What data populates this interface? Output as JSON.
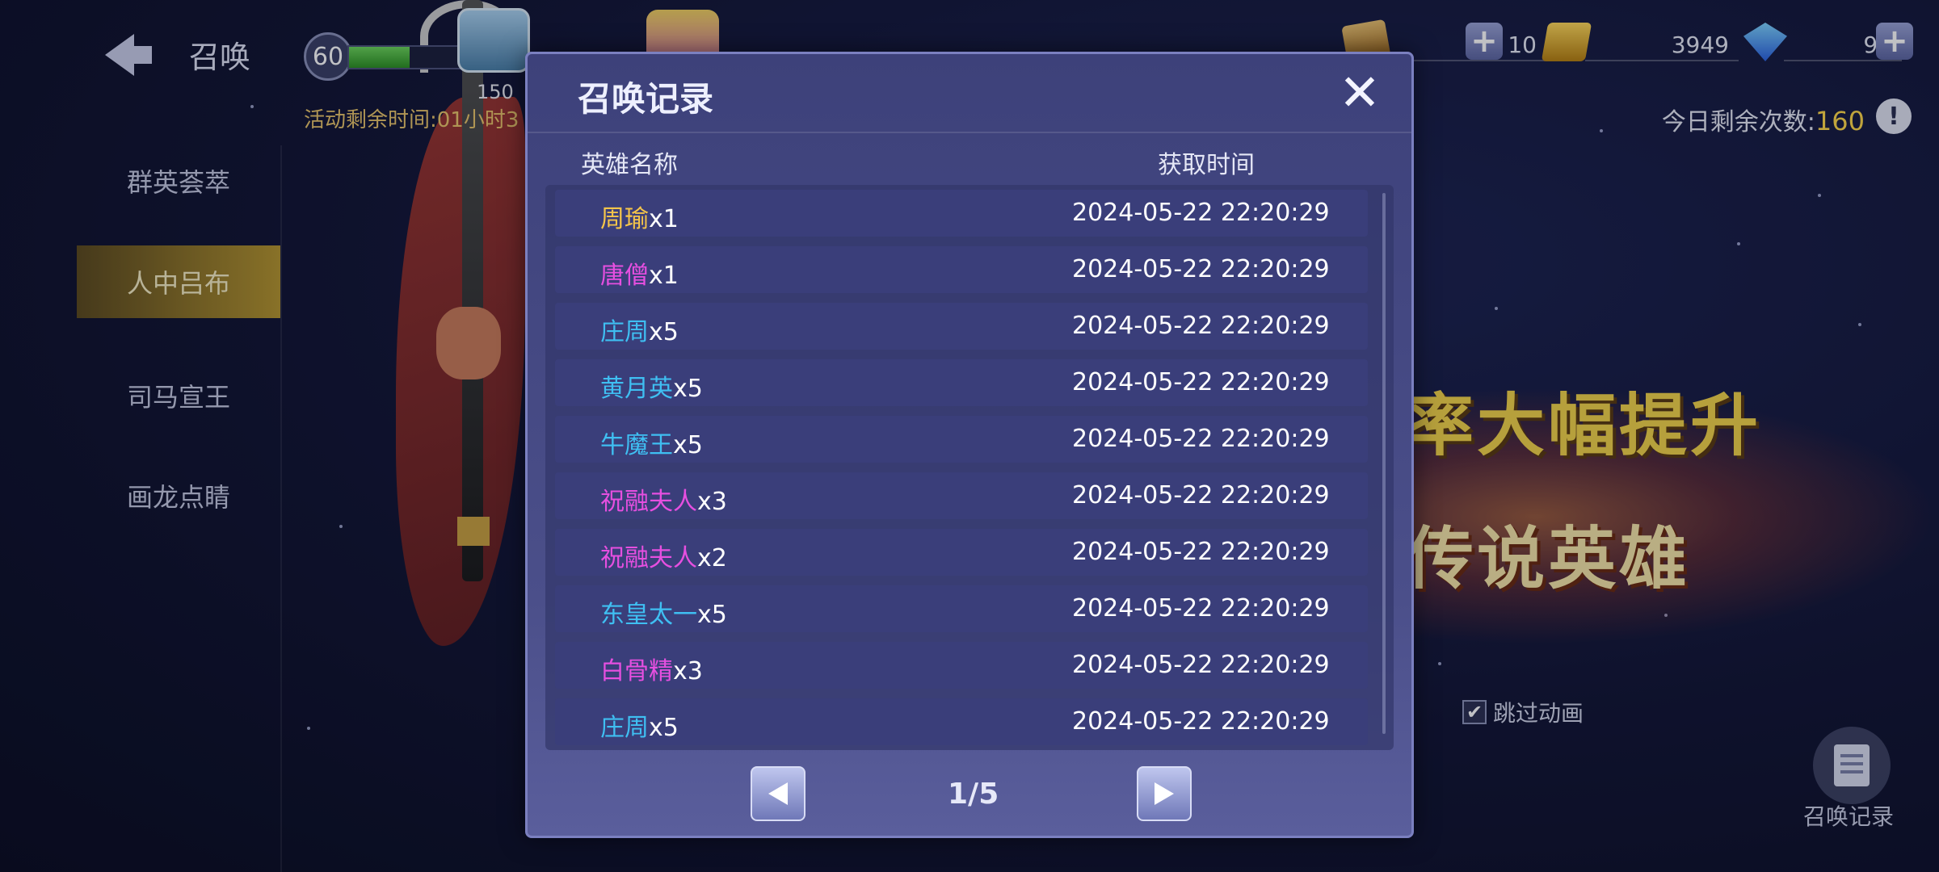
{
  "header": {
    "back_title": "召唤",
    "level": "60",
    "level_progress": 0.48,
    "chest_count": "150",
    "activity_text": "活动剩余时间:01小时3"
  },
  "currencies": {
    "tickets": "10",
    "gold": "3949",
    "gems": "91"
  },
  "remaining": {
    "label": "今日剩余次数:",
    "value": "160"
  },
  "sidebar": {
    "items": [
      {
        "label": "群英荟萃",
        "active": false
      },
      {
        "label": "人中吕布",
        "active": true
      },
      {
        "label": "司马宣王",
        "active": false
      },
      {
        "label": "画龙点睛",
        "active": false
      }
    ]
  },
  "banner": {
    "line1": "率大幅提升",
    "line2": "传说英雄"
  },
  "skip_animation": {
    "label": "跳过动画",
    "checked": true
  },
  "record_button": {
    "label": "召唤记录"
  },
  "dialog": {
    "title": "召唤记录",
    "col_name": "英雄名称",
    "col_time": "获取时间",
    "rows": [
      {
        "hero": "周瑜",
        "count": "x1",
        "time": "2024-05-22 22:20:29",
        "rarity_color": "#f5c54a"
      },
      {
        "hero": "唐僧",
        "count": "x1",
        "time": "2024-05-22 22:20:29",
        "rarity_color": "#e64fe0"
      },
      {
        "hero": "庄周",
        "count": "x5",
        "time": "2024-05-22 22:20:29",
        "rarity_color": "#3fbff2"
      },
      {
        "hero": "黄月英",
        "count": "x5",
        "time": "2024-05-22 22:20:29",
        "rarity_color": "#3fbff2"
      },
      {
        "hero": "牛魔王",
        "count": "x5",
        "time": "2024-05-22 22:20:29",
        "rarity_color": "#3fbff2"
      },
      {
        "hero": "祝融夫人",
        "count": "x3",
        "time": "2024-05-22 22:20:29",
        "rarity_color": "#e64fe0"
      },
      {
        "hero": "祝融夫人",
        "count": "x2",
        "time": "2024-05-22 22:20:29",
        "rarity_color": "#e64fe0"
      },
      {
        "hero": "东皇太一",
        "count": "x5",
        "time": "2024-05-22 22:20:29",
        "rarity_color": "#3fbff2"
      },
      {
        "hero": "白骨精",
        "count": "x3",
        "time": "2024-05-22 22:20:29",
        "rarity_color": "#e64fe0"
      },
      {
        "hero": "庄周",
        "count": "x5",
        "time": "2024-05-22 22:20:29",
        "rarity_color": "#3fbff2"
      }
    ],
    "page": "1/5"
  }
}
